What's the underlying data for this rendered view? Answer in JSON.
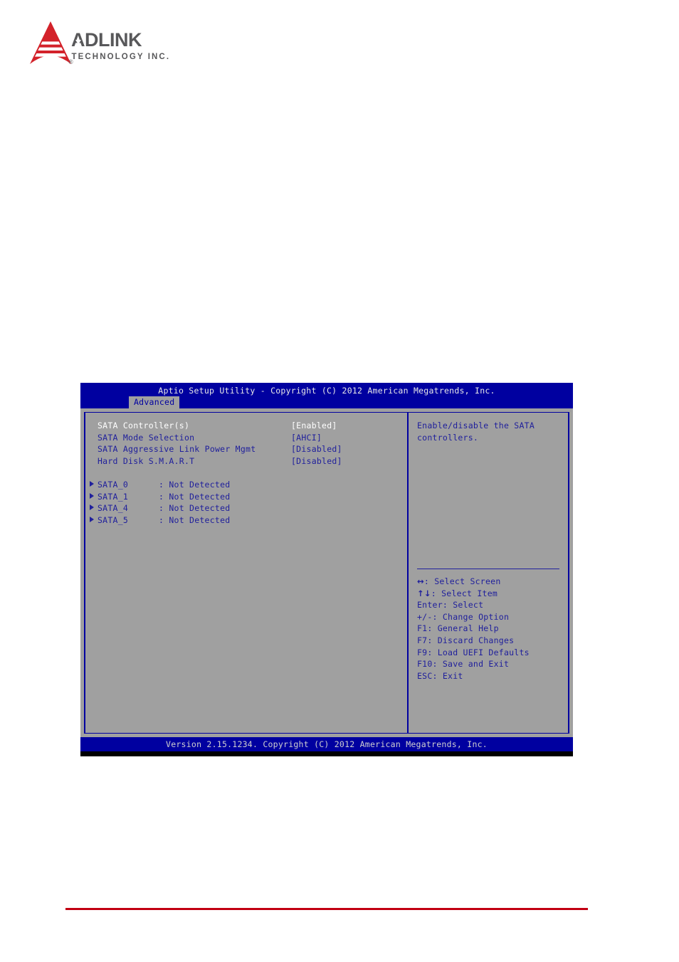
{
  "brand": {
    "name": "ADLINK",
    "tagline": "TECHNOLOGY INC.",
    "registered_mark": "®",
    "mark_color": "#d3222a",
    "word_color": "#58585a"
  },
  "bios": {
    "title": "Aptio Setup Utility - Copyright (C) 2012 American Megatrends, Inc.",
    "tab": "Advanced",
    "footer": "Version 2.15.1234. Copyright (C) 2012 American Megatrends, Inc.",
    "colors": {
      "header_bg": "#0000a0",
      "panel_bg": "#a0a0a0",
      "text": "#20209c",
      "selected_text": "#ffffff",
      "header_text": "#e8e8e8"
    },
    "options": [
      {
        "label": "SATA Controller(s)",
        "value": "[Enabled]",
        "selected": true
      },
      {
        "label": "SATA Mode Selection",
        "value": "[AHCI]",
        "selected": false
      },
      {
        "label": "SATA Aggressive Link Power Mgmt",
        "value": "[Disabled]",
        "selected": false
      },
      {
        "label": "Hard Disk S.M.A.R.T",
        "value": "[Disabled]",
        "selected": false
      }
    ],
    "devices": [
      {
        "label": "SATA_0",
        "value": ": Not Detected"
      },
      {
        "label": "SATA_1",
        "value": ": Not Detected"
      },
      {
        "label": "SATA_4",
        "value": ": Not Detected"
      },
      {
        "label": "SATA_5",
        "value": ": Not Detected"
      }
    ],
    "help": [
      "Enable/disable the SATA",
      "controllers."
    ],
    "keys": [
      {
        "glyph": "↔",
        "text": ": Select Screen"
      },
      {
        "glyph": "↑↓",
        "text": ": Select Item"
      },
      {
        "glyph": "",
        "text": "Enter: Select"
      },
      {
        "glyph": "",
        "text": "+/-: Change Option"
      },
      {
        "glyph": "",
        "text": "F1: General Help"
      },
      {
        "glyph": "",
        "text": "F7: Discard Changes"
      },
      {
        "glyph": "",
        "text": "F9: Load UEFI Defaults"
      },
      {
        "glyph": "",
        "text": "F10: Save and Exit"
      },
      {
        "glyph": "",
        "text": "ESC: Exit"
      }
    ]
  },
  "page": {
    "rule_color": "#c20012"
  }
}
